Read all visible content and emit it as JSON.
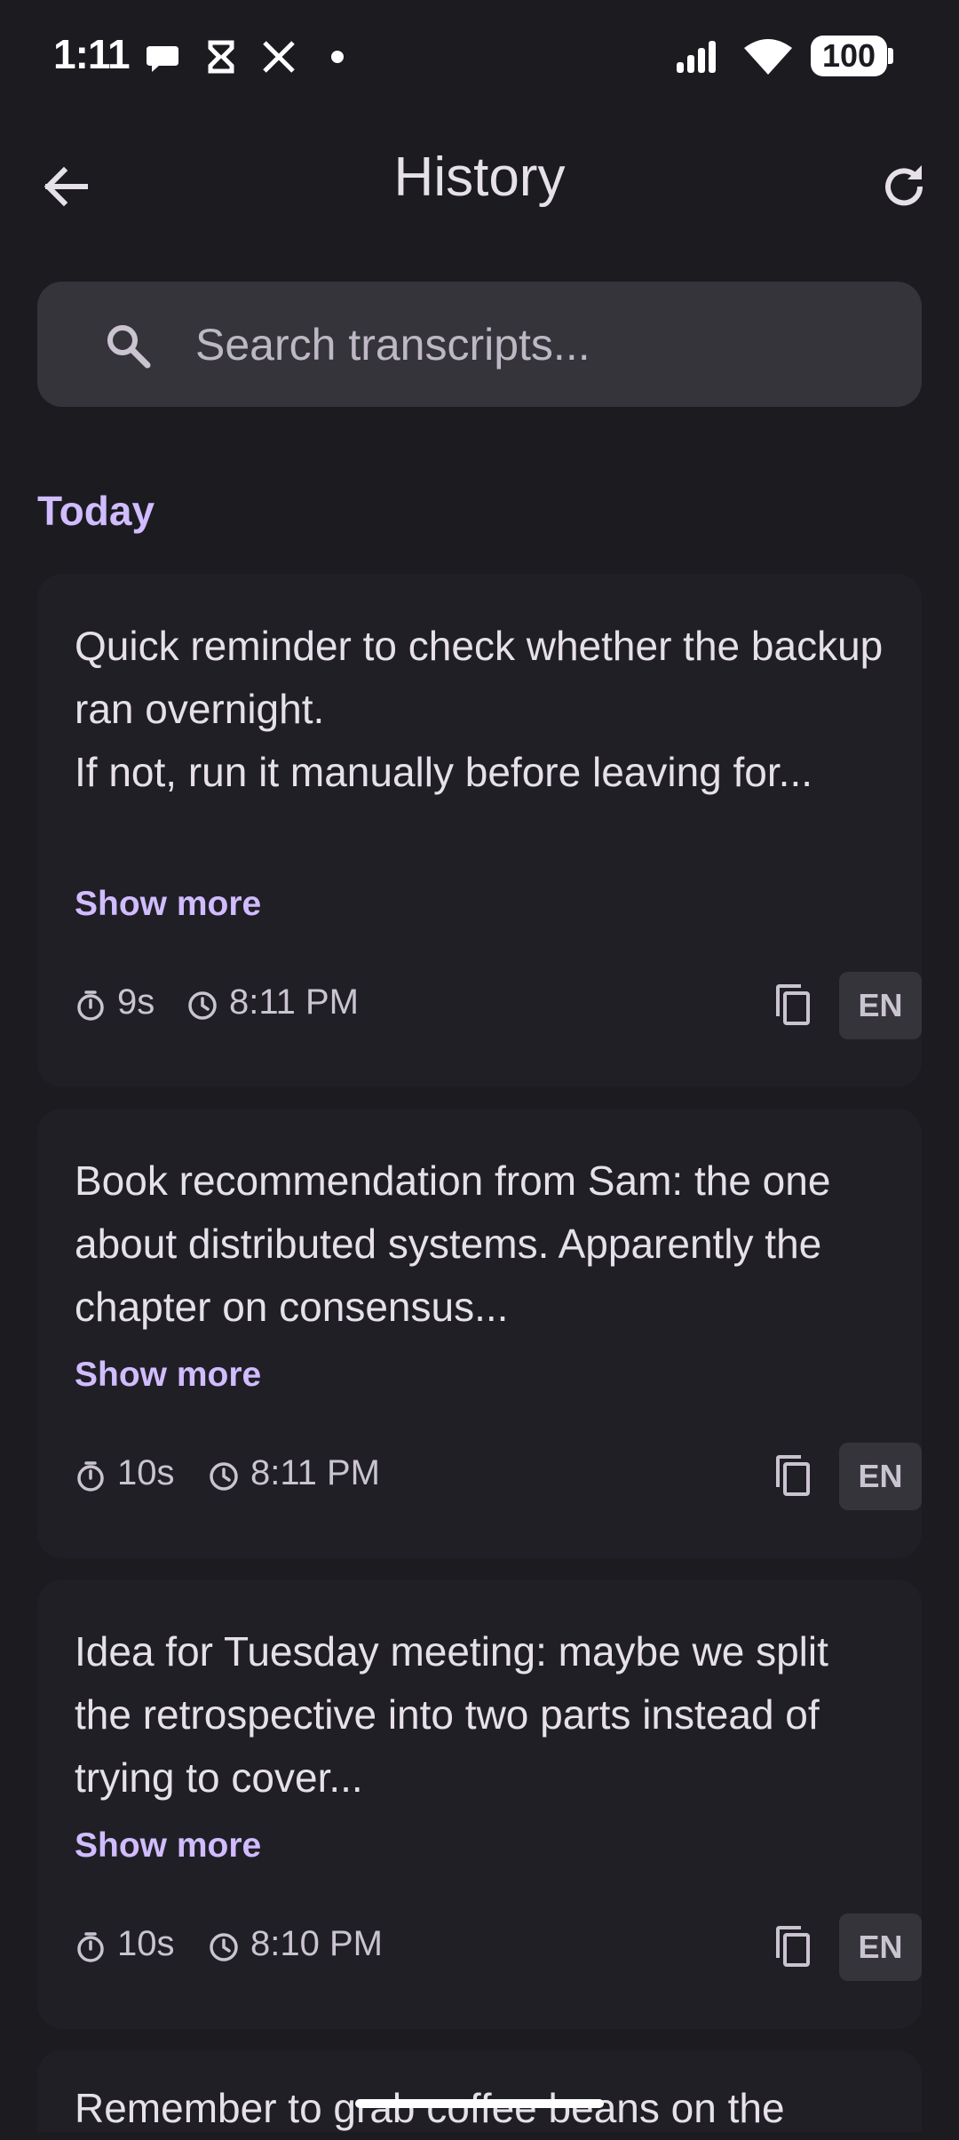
{
  "status_bar": {
    "time": "1:11",
    "battery": "100",
    "icons": [
      "chat-bubble-icon",
      "hourglass-icon",
      "x-logo-icon",
      "dot-icon",
      "signal-icon",
      "wifi-icon",
      "battery-icon"
    ]
  },
  "app_bar": {
    "title": "History",
    "back_icon": "arrow-left-icon",
    "refresh_icon": "refresh-icon"
  },
  "search": {
    "placeholder": "Search transcripts...",
    "value": ""
  },
  "sections": [
    {
      "header": "Today",
      "items": [
        {
          "text": "Quick reminder to check whether the backup ran overnight.\nIf not, run it manually before leaving for...",
          "show_more": "Show more",
          "duration": "9s",
          "time": "8:11 PM",
          "language": "EN"
        },
        {
          "text": "Book recommendation from Sam: the one about distributed systems. Apparently the chapter on consensus...",
          "show_more": "Show more",
          "duration": "10s",
          "time": "8:11 PM",
          "language": "EN"
        },
        {
          "text": "Idea for Tuesday meeting: maybe we split the retrospective into two parts instead of trying to cover...",
          "show_more": "Show more",
          "duration": "10s",
          "time": "8:10 PM",
          "language": "EN"
        },
        {
          "text": "Remember to grab coffee beans on the"
        }
      ]
    }
  ],
  "colors": {
    "background": "#1c1b20",
    "card": "#211f26",
    "accent": "#d0bcff",
    "search_bg": "#36343b",
    "text_primary": "#e6e1e9",
    "text_secondary": "#cac4d0"
  }
}
